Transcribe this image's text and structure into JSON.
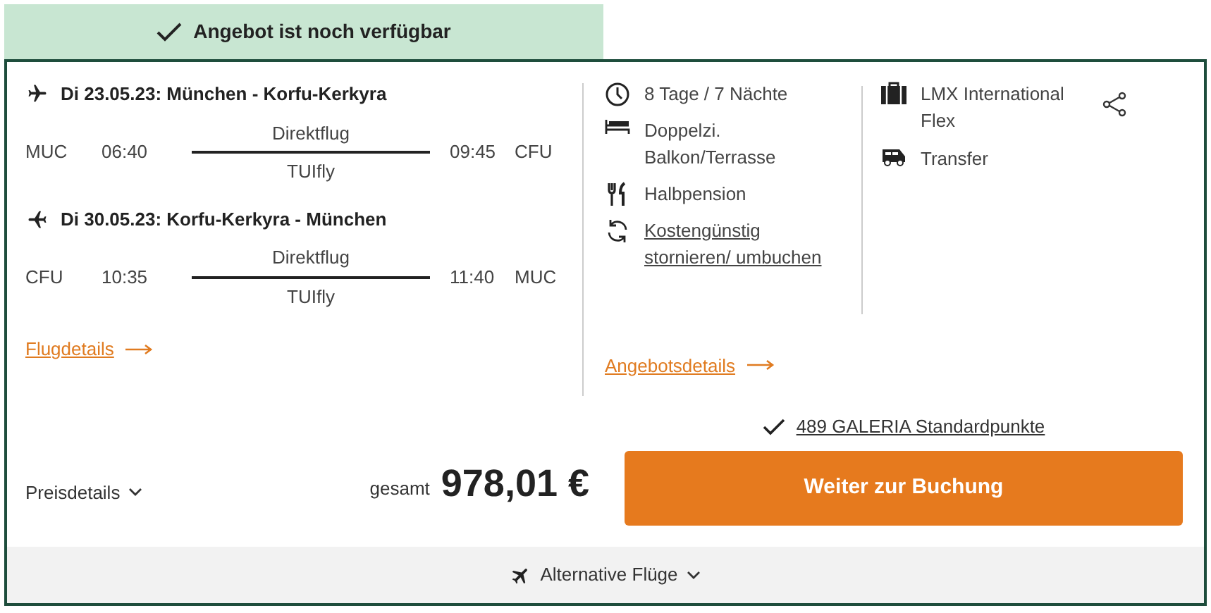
{
  "availability": {
    "label": "Angebot ist noch verfügbar"
  },
  "flights": [
    {
      "kind": "outbound",
      "heading": "Di 23.05.23: München - Korfu-Kerkyra",
      "from": "MUC",
      "departure": "06:40",
      "type": "Direktflug",
      "airline": "TUIfly",
      "arrival": "09:45",
      "to": "CFU"
    },
    {
      "kind": "return",
      "heading": "Di 30.05.23: Korfu-Kerkyra - München",
      "from": "CFU",
      "departure": "10:35",
      "type": "Direktflug",
      "airline": "TUIfly",
      "arrival": "11:40",
      "to": "MUC"
    }
  ],
  "flight_details_link": "Flugdetails",
  "features": [
    {
      "kind": "duration",
      "text": "8 Tage / 7 Nächte"
    },
    {
      "kind": "room",
      "text": "Doppelzi. Balkon/Terrasse"
    },
    {
      "kind": "meals",
      "text": "Halbpension"
    },
    {
      "kind": "cancellation",
      "text": "Kostengünstig stornieren/ umbuchen"
    }
  ],
  "offer_details_link": "Angebotsdetails",
  "extras": [
    {
      "kind": "tariff",
      "text": "LMX International Flex"
    },
    {
      "kind": "transfer",
      "text": "Transfer"
    }
  ],
  "points": "489 GALERIA Standardpunkte",
  "price_details": "Preisdetails",
  "total_label": "gesamt",
  "total": "978,01 €",
  "book_button": "Weiter zur Buchung",
  "alternative_flights": "Alternative Flüge"
}
